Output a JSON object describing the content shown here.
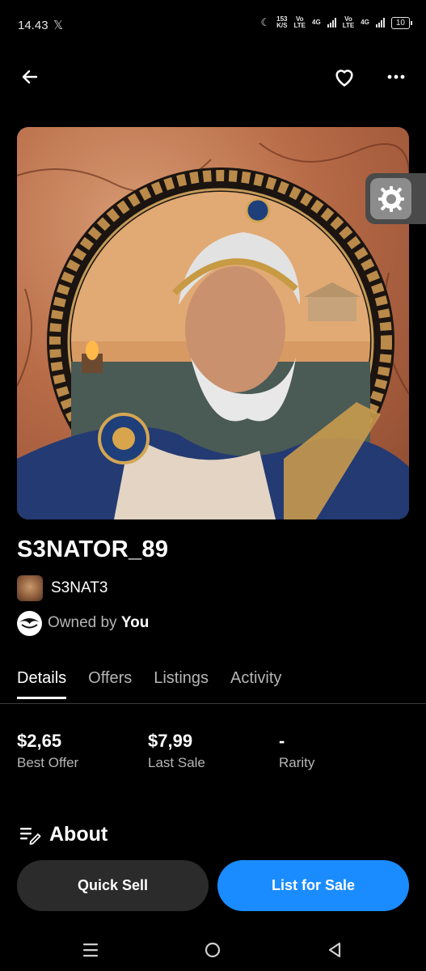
{
  "status_bar": {
    "time": "14.43",
    "x_app": "𝕏",
    "net_speed_value": "153",
    "net_speed_unit": "K/S",
    "sim1_top": "Vo",
    "sim1_bottom": "LTE",
    "sim1_gen": "4G",
    "sim2_top": "Vo",
    "sim2_bottom": "LTE",
    "sim2_gen": "4G",
    "battery": "10"
  },
  "app_bar": {
    "back_icon": "arrow-left-icon",
    "favorite_icon": "heart-outline-icon",
    "more_icon": "more-horizontal-icon"
  },
  "artwork": {
    "description_icon": "greek-senator-bust-artwork"
  },
  "floating_button": {
    "icon": "settings-gear-icon"
  },
  "nft": {
    "title": "S3NATOR_89",
    "collection": "S3NAT3",
    "owned_by_label": "Owned by",
    "owner": "You"
  },
  "tabs": [
    {
      "label": "Details",
      "active": true
    },
    {
      "label": "Offers",
      "active": false
    },
    {
      "label": "Listings",
      "active": false
    },
    {
      "label": "Activity",
      "active": false
    }
  ],
  "stats": [
    {
      "value": "$2,65",
      "label": "Best Offer"
    },
    {
      "value": "$7,99",
      "label": "Last Sale"
    },
    {
      "value": "-",
      "label": "Rarity"
    }
  ],
  "about": {
    "title": "About",
    "icon": "notes-edit-icon"
  },
  "actions": {
    "quick_sell": "Quick Sell",
    "list_for_sale": "List for Sale"
  },
  "nav": {
    "recents_icon": "menu-lines-icon",
    "home_icon": "circle-home-icon",
    "back_icon": "triangle-back-icon"
  },
  "colors": {
    "background": "#000000",
    "primary_button": "#1a8cff",
    "secondary_button": "#2b2b2b",
    "muted_text": "#b5b5b5"
  }
}
